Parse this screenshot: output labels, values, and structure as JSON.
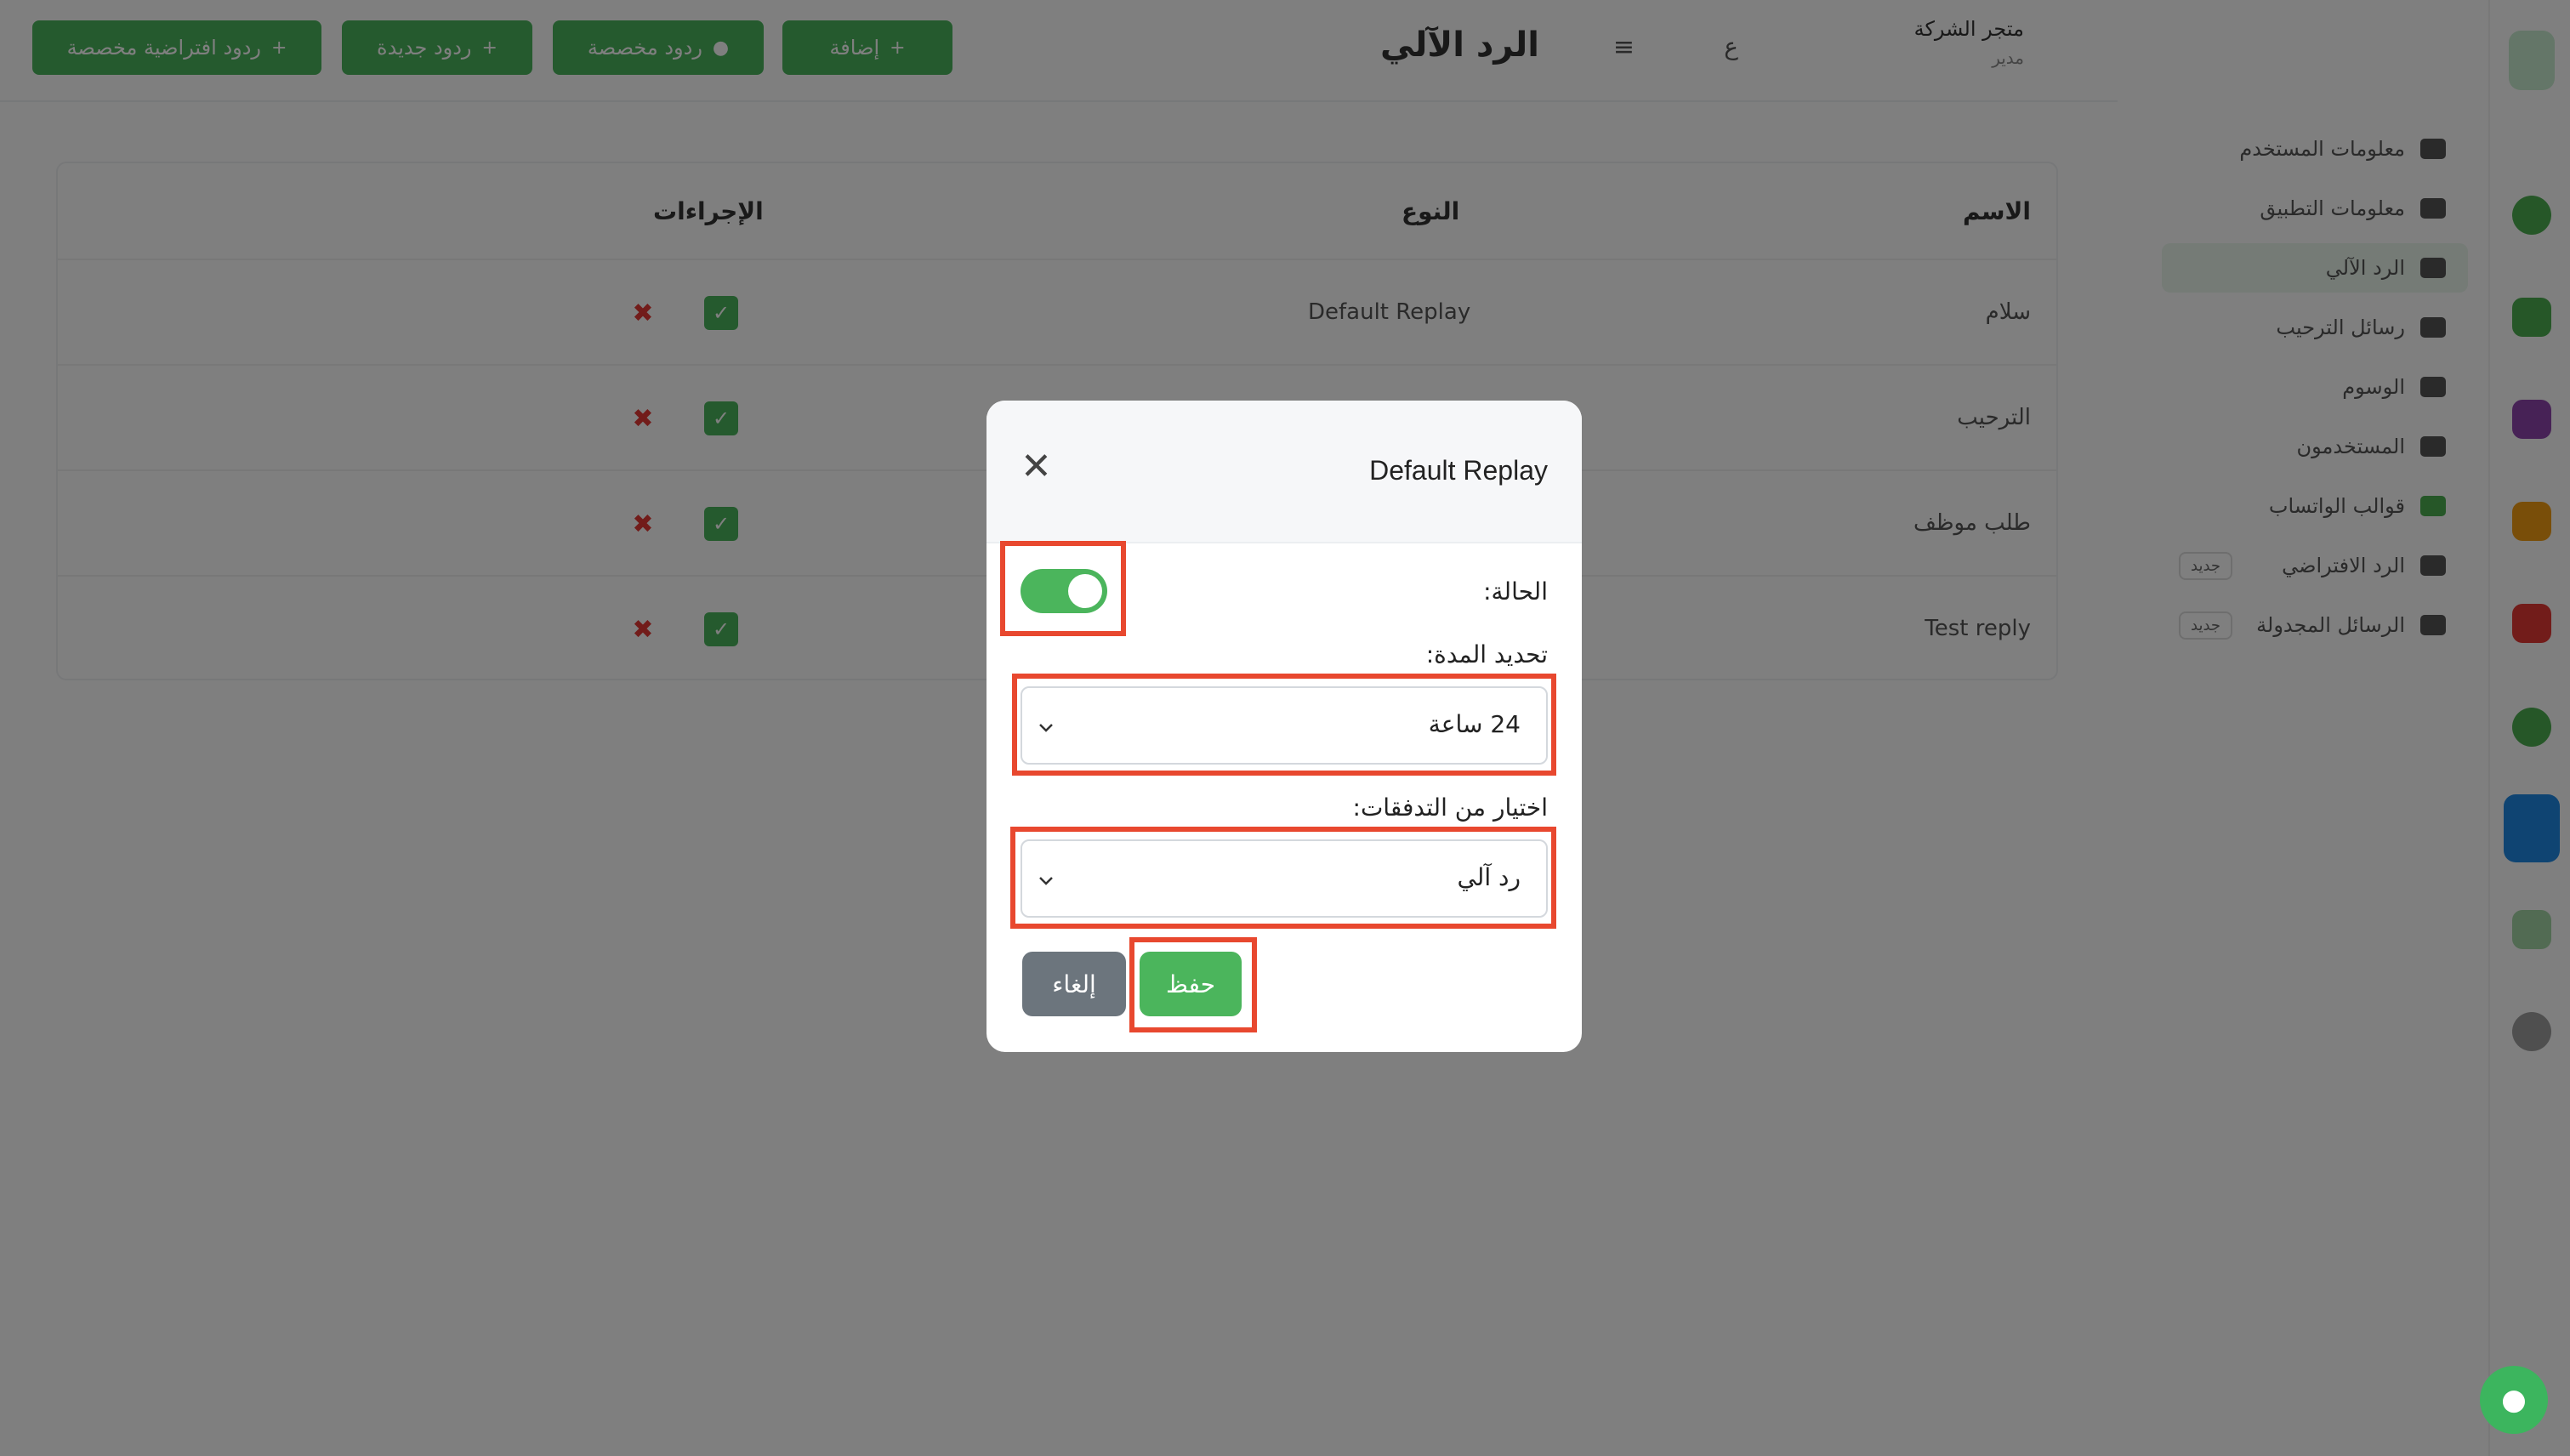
{
  "header": {
    "page_title": "الرد الآلي",
    "buttons": [
      {
        "label": "إضافة",
        "icon": "plus-icon"
      },
      {
        "label": "ردود مخصصة",
        "icon": "chat-icon"
      },
      {
        "label": "ردود جديدة",
        "icon": "plus-icon"
      },
      {
        "label": "ردود افتراضية مخصصة",
        "icon": "plus-icon"
      }
    ],
    "user_name": "متجر الشركة",
    "user_role": "مدير"
  },
  "sidebar": {
    "items": [
      {
        "label": "معلومات المستخدم",
        "badge": ""
      },
      {
        "label": "معلومات التطبيق",
        "badge": ""
      },
      {
        "label": "الرد الآلي",
        "badge": ""
      },
      {
        "label": "رسائل الترحيب",
        "badge": ""
      },
      {
        "label": "الوسوم",
        "badge": ""
      },
      {
        "label": "المستخدمون",
        "badge": ""
      },
      {
        "label": "قوالب الواتساب",
        "badge": ""
      },
      {
        "label": "الرد الافتراضي",
        "badge": "جديد"
      },
      {
        "label": "الرسائل المجدولة",
        "badge": "جديد"
      }
    ]
  },
  "table": {
    "headers": [
      "الاسم",
      "النوع",
      "الإجراءات"
    ],
    "rows": [
      {
        "name": "سلام",
        "type": "Default Replay"
      },
      {
        "name": "الترحيب",
        "type": ""
      },
      {
        "name": "طلب موظف",
        "type": ""
      },
      {
        "name": "Test reply",
        "type": ""
      }
    ]
  },
  "modal": {
    "title": "Default Replay",
    "status_label": "الحالة:",
    "status_on": true,
    "duration_label": "تحديد المدة:",
    "duration_value": "24 ساعة",
    "flow_label": "اختيار من التدفقات:",
    "flow_value": "رد آلي",
    "save_label": "حفظ",
    "cancel_label": "إلغاء"
  },
  "colors": {
    "accent": "#4bb55c",
    "highlight": "#e8482f",
    "danger": "#e53935"
  }
}
